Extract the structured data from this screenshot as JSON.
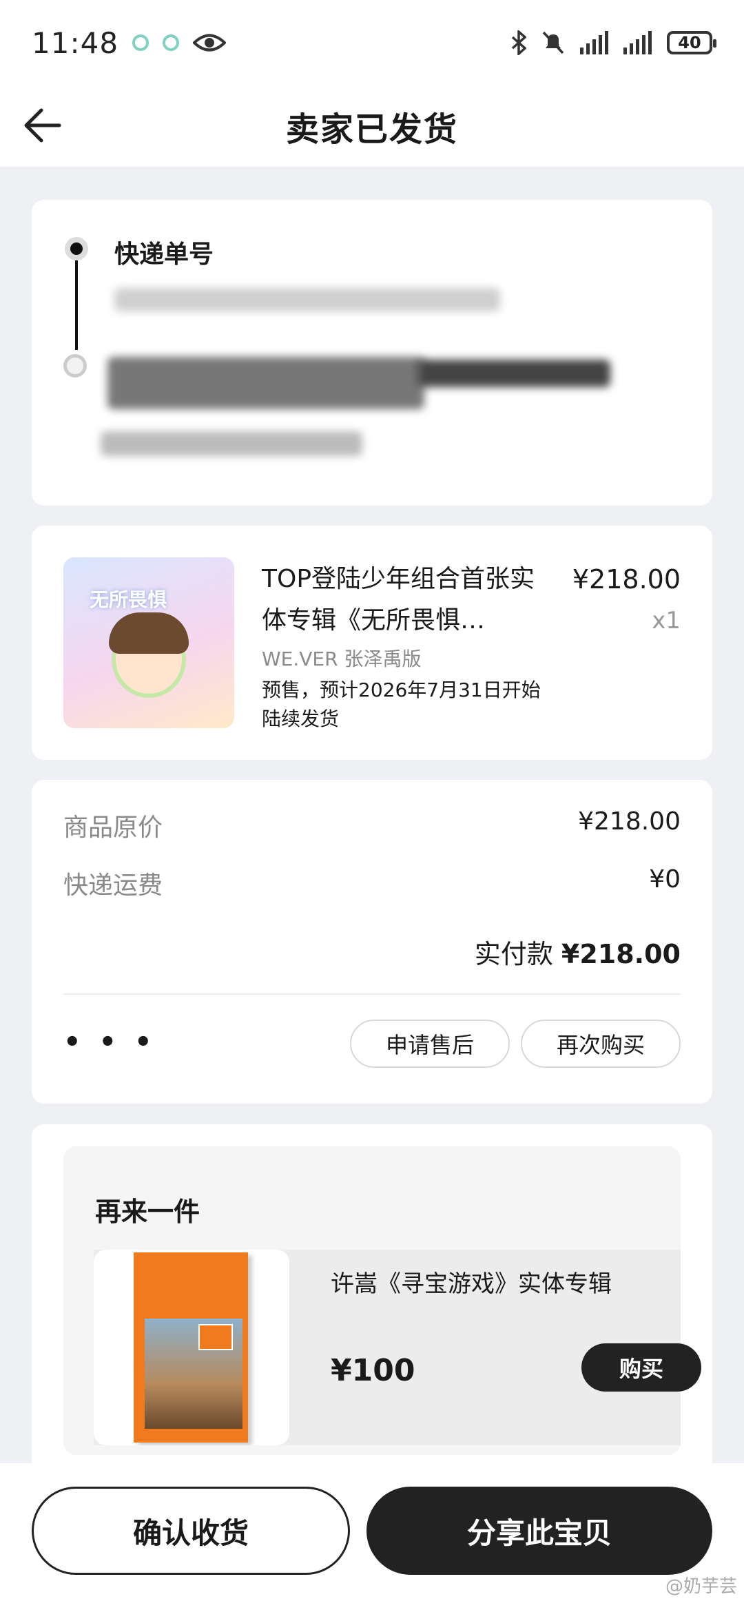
{
  "status_bar": {
    "time": "11:48",
    "battery": "40"
  },
  "header": {
    "title": "卖家已发货"
  },
  "logistics": {
    "title": "快递单号"
  },
  "product": {
    "name": "TOP登陆少年组合首张实体专辑《无所畏惧…",
    "price": "¥218.00",
    "quantity": "x1",
    "spec": "WE.VER 张泽禹版",
    "note": "预售，预计2026年7月31日开始陆续发货",
    "thumb_text": "无所畏惧"
  },
  "summary": {
    "original_price_label": "商品原价",
    "original_price_value": "¥218.00",
    "shipping_label": "快递运费",
    "shipping_value": "¥0",
    "paid_label": "实付款",
    "paid_value": "¥218.00",
    "more": "• • •",
    "after_sale": "申请售后",
    "buy_again": "再次购买"
  },
  "recommend": {
    "title": "再来一件",
    "item_name": "许嵩《寻宝游戏》实体专辑",
    "item_price": "¥100",
    "buy_label": "购买"
  },
  "bottom_bar": {
    "confirm_label": "确认收货",
    "share_label": "分享此宝贝"
  },
  "watermark": "@奶芋芸"
}
